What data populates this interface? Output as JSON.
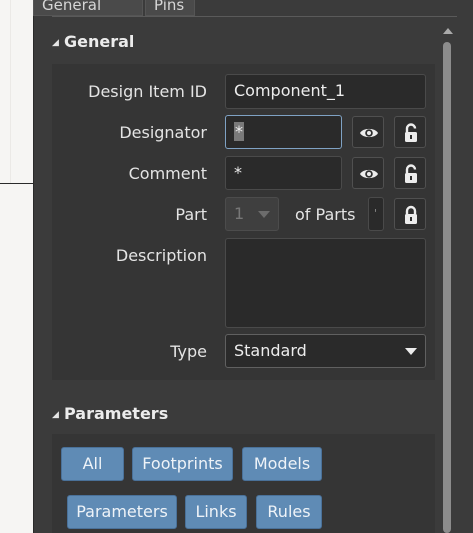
{
  "tabs": [
    {
      "label": "General"
    },
    {
      "label": "Pins"
    }
  ],
  "general": {
    "title": "General",
    "design_item_id": {
      "label": "Design Item ID",
      "value": "Component_1"
    },
    "designator": {
      "label": "Designator",
      "value": "*"
    },
    "comment": {
      "label": "Comment",
      "value": "*"
    },
    "part": {
      "label": "Part",
      "value": "1",
      "of_parts_label": "of Parts",
      "of_parts_value": "'"
    },
    "description": {
      "label": "Description",
      "value": ""
    },
    "type": {
      "label": "Type",
      "value": "Standard"
    }
  },
  "parameters": {
    "title": "Parameters",
    "filters_row1": [
      "All",
      "Footprints",
      "Models"
    ],
    "filters_row2": [
      "Parameters",
      "Links",
      "Rules"
    ]
  },
  "icons": {
    "visibility": "eye-icon",
    "lock": "lock-icon"
  },
  "colors": {
    "panel_bg": "#3b3b3b",
    "group_bg": "#353535",
    "field_bg": "#2a2a2a",
    "filter_button": "#5f8bb5",
    "focus_border": "#7fa2c4"
  }
}
